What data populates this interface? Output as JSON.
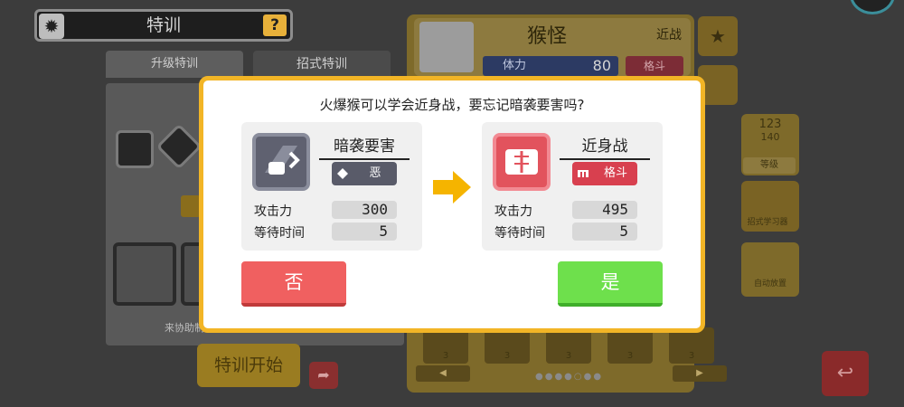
{
  "header": {
    "title": "特训",
    "help_label": "?"
  },
  "tabs": [
    {
      "label": "升级特训"
    },
    {
      "label": "招式特训"
    }
  ],
  "left_panel": {
    "helper_text": "来协助制"
  },
  "start_button": {
    "label": "特训开始"
  },
  "monster": {
    "name": "猴怪",
    "type_label": "近战",
    "hp_label": "体力",
    "hp_value": "80",
    "badge_label": "格斗"
  },
  "side_panel": {
    "level_current": "123",
    "level_max": "140",
    "level_label": "等级",
    "skill_label": "招式学习器",
    "auto_label": "自动放置"
  },
  "bottom_cards": [
    {
      "count": "3"
    },
    {
      "count": "3"
    },
    {
      "count": "3"
    },
    {
      "count": "3"
    },
    {
      "count": "3"
    }
  ],
  "pager": {
    "prev": "◀",
    "next": "▶",
    "dots": "●●●●○●●"
  },
  "dialog": {
    "question": "火爆猴可以学会近身战，要忘记暗袭要害吗?",
    "old_move": {
      "name": "暗袭要害",
      "type": "恶",
      "attack_label": "攻击力",
      "attack_value": "300",
      "wait_label": "等待时间",
      "wait_value": "5"
    },
    "new_move": {
      "name": "近身战",
      "type": "格斗",
      "attack_label": "攻击力",
      "attack_value": "495",
      "wait_label": "等待时间",
      "wait_value": "5"
    },
    "no_label": "否",
    "yes_label": "是"
  },
  "colors": {
    "dialog_border": "#f2b526",
    "no_button": "#f06060",
    "yes_button": "#6ee04c",
    "dark_type": "#595b69",
    "fight_type": "#d8404f",
    "arrow": "#f5b400"
  }
}
